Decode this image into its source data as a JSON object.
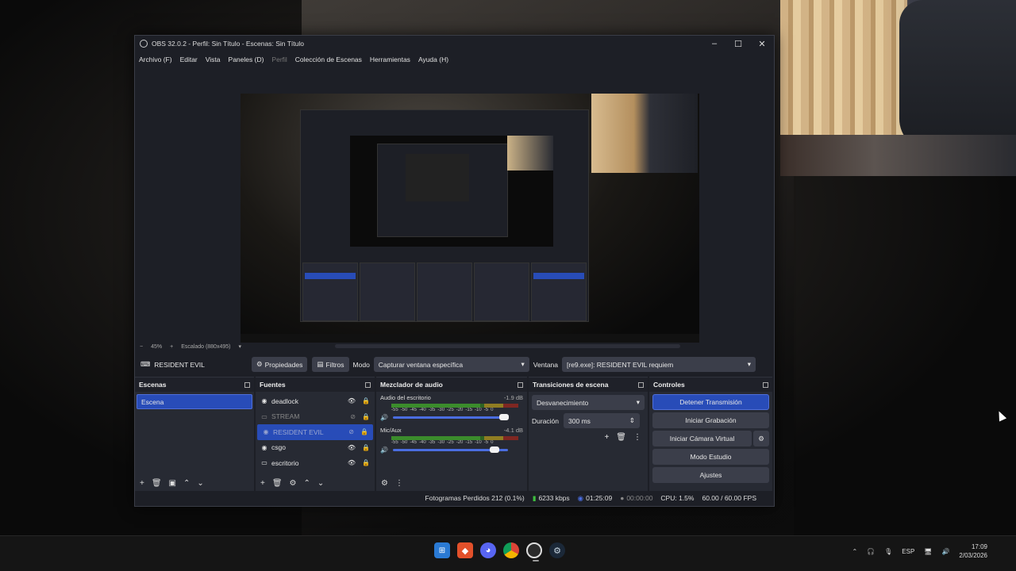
{
  "window": {
    "title": "OBS 32.0.2 - Perfil: Sin Título - Escenas: Sin Título",
    "controls": [
      "–",
      "☐",
      "✕"
    ]
  },
  "menu": [
    "Archivo (F)",
    "Editar",
    "Vista",
    "Paneles (D)",
    "Perfil",
    "Colección de Escenas",
    "Herramientas",
    "Ayuda (H)"
  ],
  "preview_bar": {
    "zoom": "45%",
    "scale": "Escalado (880x495)"
  },
  "source_bar": {
    "current_source": "RESIDENT EVIL",
    "properties": "Propiedades",
    "filters": "Filtros",
    "mode_label": "Modo",
    "mode_value": "Capturar ventana específica",
    "window_label": "Ventana",
    "window_value": "[re9.exe]: RESIDENT EVIL requiem"
  },
  "docks": {
    "scenes": {
      "title": "Escenas",
      "items": [
        "Escena"
      ]
    },
    "sources": {
      "title": "Fuentes",
      "items": [
        {
          "name": "deadlock",
          "icon": "gamepad-icon",
          "visible": true
        },
        {
          "name": "STREAM",
          "icon": "window-icon",
          "visible": false
        },
        {
          "name": "RESIDENT EVIL",
          "icon": "gamepad-icon",
          "visible": false
        },
        {
          "name": "csgo",
          "icon": "gamepad-icon",
          "visible": true
        },
        {
          "name": "escritorio",
          "icon": "monitor-icon",
          "visible": true
        }
      ]
    },
    "mixer": {
      "title": "Mezclador de audio",
      "ticks": [
        "-60",
        "-55",
        "-50",
        "-45",
        "-40",
        "-35",
        "-30",
        "-25",
        "-20",
        "-15",
        "-10",
        "-5",
        "0"
      ],
      "channels": [
        {
          "name": "Audio del escritorio",
          "db": "-1.9 dB",
          "volume": 0.92
        },
        {
          "name": "Mic/Aux",
          "db": "-4.1 dB",
          "volume": 0.84
        }
      ]
    },
    "transitions": {
      "title": "Transiciones de escena",
      "type": "Desvanecimiento",
      "duration_label": "Duración",
      "duration_value": "300 ms"
    },
    "controls": {
      "title": "Controles",
      "stop_stream": "Detener Transmisión",
      "start_recording": "Iniciar Grabación",
      "start_virtual_cam": "Iniciar Cámara Virtual",
      "studio_mode": "Modo Estudio",
      "settings": "Ajustes"
    }
  },
  "status": {
    "dropped_frames": "Fotogramas Perdidos 212 (0.1%)",
    "bitrate": "6233 kbps",
    "stream_time": "01:25:09",
    "rec_time": "00:00:00",
    "cpu": "CPU: 1.5%",
    "fps": "60.00 / 60.00 FPS"
  },
  "taskbar": {
    "apps": [
      "windows-start-icon",
      "brave-icon",
      "discord-icon",
      "chrome-icon",
      "obs-icon",
      "steam-icon"
    ],
    "language": "ESP",
    "time": "17:09",
    "date": "2/03/2026"
  },
  "colors": {
    "accent": "#284cb8",
    "panel": "#272a33",
    "background": "#1d1f26"
  }
}
